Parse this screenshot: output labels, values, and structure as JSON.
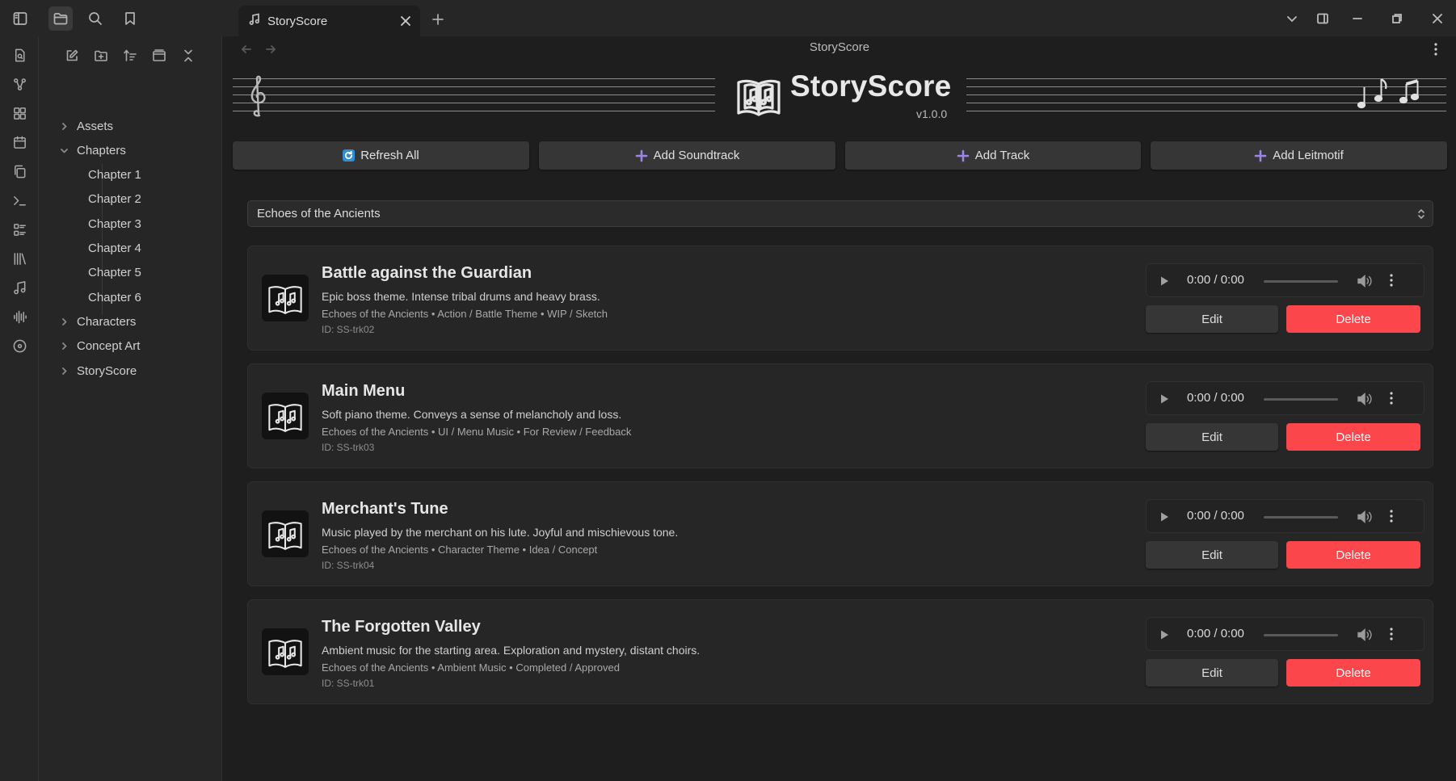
{
  "tab": {
    "title": "StoryScore"
  },
  "view": {
    "title": "StoryScore"
  },
  "explorer": {
    "items": [
      {
        "label": "Assets",
        "expanded": false,
        "depth": 0
      },
      {
        "label": "Chapters",
        "expanded": true,
        "depth": 0
      },
      {
        "label": "Chapter 1",
        "depth": 1
      },
      {
        "label": "Chapter 2",
        "depth": 1
      },
      {
        "label": "Chapter 3",
        "depth": 1
      },
      {
        "label": "Chapter 4",
        "depth": 1
      },
      {
        "label": "Chapter 5",
        "depth": 1
      },
      {
        "label": "Chapter 6",
        "depth": 1
      },
      {
        "label": "Characters",
        "expanded": false,
        "depth": 0
      },
      {
        "label": "Concept Art",
        "expanded": false,
        "depth": 0
      },
      {
        "label": "StoryScore",
        "expanded": false,
        "depth": 0
      }
    ]
  },
  "plugin": {
    "title": "StoryScore",
    "version": "v1.0.0",
    "actions": {
      "refresh": "Refresh All",
      "add_soundtrack": "Add Soundtrack",
      "add_track": "Add Track",
      "add_leitmotif": "Add Leitmotif"
    },
    "soundtrack_selected": "Echoes of the Ancients",
    "edit_label": "Edit",
    "delete_label": "Delete",
    "tracks": [
      {
        "title": "Battle against the Guardian",
        "description": "Epic boss theme. Intense tribal drums and heavy brass.",
        "meta": "Echoes of the Ancients • Action / Battle Theme • WIP / Sketch",
        "id": "ID: SS-trk02",
        "time": "0:00 / 0:00",
        "progress": 0
      },
      {
        "title": "Main Menu",
        "description": "Soft piano theme. Conveys a sense of melancholy and loss.",
        "meta": "Echoes of the Ancients • UI / Menu Music • For Review / Feedback",
        "id": "ID: SS-trk03",
        "time": "0:00 / 0:00",
        "progress": 0
      },
      {
        "title": "Merchant's Tune",
        "description": "Music played by the merchant on his lute. Joyful and mischievous tone.",
        "meta": "Echoes of the Ancients • Character Theme • Idea / Concept",
        "id": "ID: SS-trk04",
        "time": "0:00 / 0:00",
        "progress": 0
      },
      {
        "title": "The Forgotten Valley",
        "description": "Ambient music for the starting area. Exploration and mystery, distant choirs.",
        "meta": "Echoes of the Ancients • Ambient Music • Completed / Approved",
        "id": "ID: SS-trk01",
        "time": "0:00 / 0:00",
        "progress": 0
      }
    ]
  },
  "colors": {
    "accent": "#9b85e8",
    "delete": "#fb464c",
    "refresh_icon": "#2e8ed8",
    "background": "#1e1e1e",
    "panel": "#262626"
  },
  "icons": {
    "ribbon": [
      "file-icon",
      "graph-icon",
      "canvas-icon",
      "calendar-icon",
      "copy-icon",
      "terminal-icon",
      "list-icon",
      "library-icon",
      "music-note-icon",
      "waveform-icon",
      "disc-icon"
    ]
  }
}
